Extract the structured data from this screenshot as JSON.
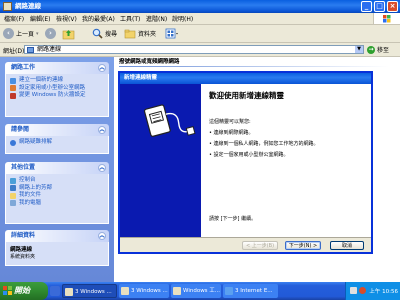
{
  "window": {
    "title": "網路連線"
  },
  "menubar": {
    "items": [
      "檔案(F)",
      "編輯(E)",
      "檢視(V)",
      "我的最愛(A)",
      "工具(T)",
      "進階(N)",
      "說明(H)"
    ]
  },
  "toolbar": {
    "back_label": "上一頁",
    "search_label": "搜尋",
    "folders_label": "資料夾"
  },
  "address": {
    "label": "網址(D)",
    "value": "網路連線",
    "go_label": "移至"
  },
  "sidebar": {
    "network_tasks": {
      "title": "網路工作",
      "items": [
        "建立一個新的連線",
        "設定家用或小型辦公室網路",
        "變更 Windows 防火牆設定"
      ]
    },
    "see_also": {
      "title": "請參閱",
      "items": [
        "網路疑難排解"
      ]
    },
    "other_places": {
      "title": "其他位置",
      "items": [
        "控制台",
        "網路上的芳鄰",
        "我的文件",
        "我的電腦"
      ]
    },
    "details": {
      "title": "詳細資料",
      "name": "網路連線",
      "type": "系統資料夾"
    }
  },
  "main": {
    "header": "撥號網路或寬頻網際網路"
  },
  "wizard": {
    "title": "新增連線精靈",
    "heading": "歡迎使用新增連線精靈",
    "intro": "這個精靈可以幫您:",
    "bullets": [
      "連線到網際網路。",
      "連線到一個私人網路，例如您工作地方的網路。",
      "設定一個家用或小型辦公室網路。"
    ],
    "continue_text": "請按 [下一步] 繼續。",
    "back_button": "< 上一步(B)",
    "next_button": "下一步(N) >",
    "cancel_button": "取消"
  },
  "taskbar": {
    "start_label": "開始",
    "tasks": [
      "3 Windows ...",
      "3 Windows ...",
      "Windows 工...",
      "3 Internet E..."
    ],
    "clock": "上午 10:56"
  }
}
